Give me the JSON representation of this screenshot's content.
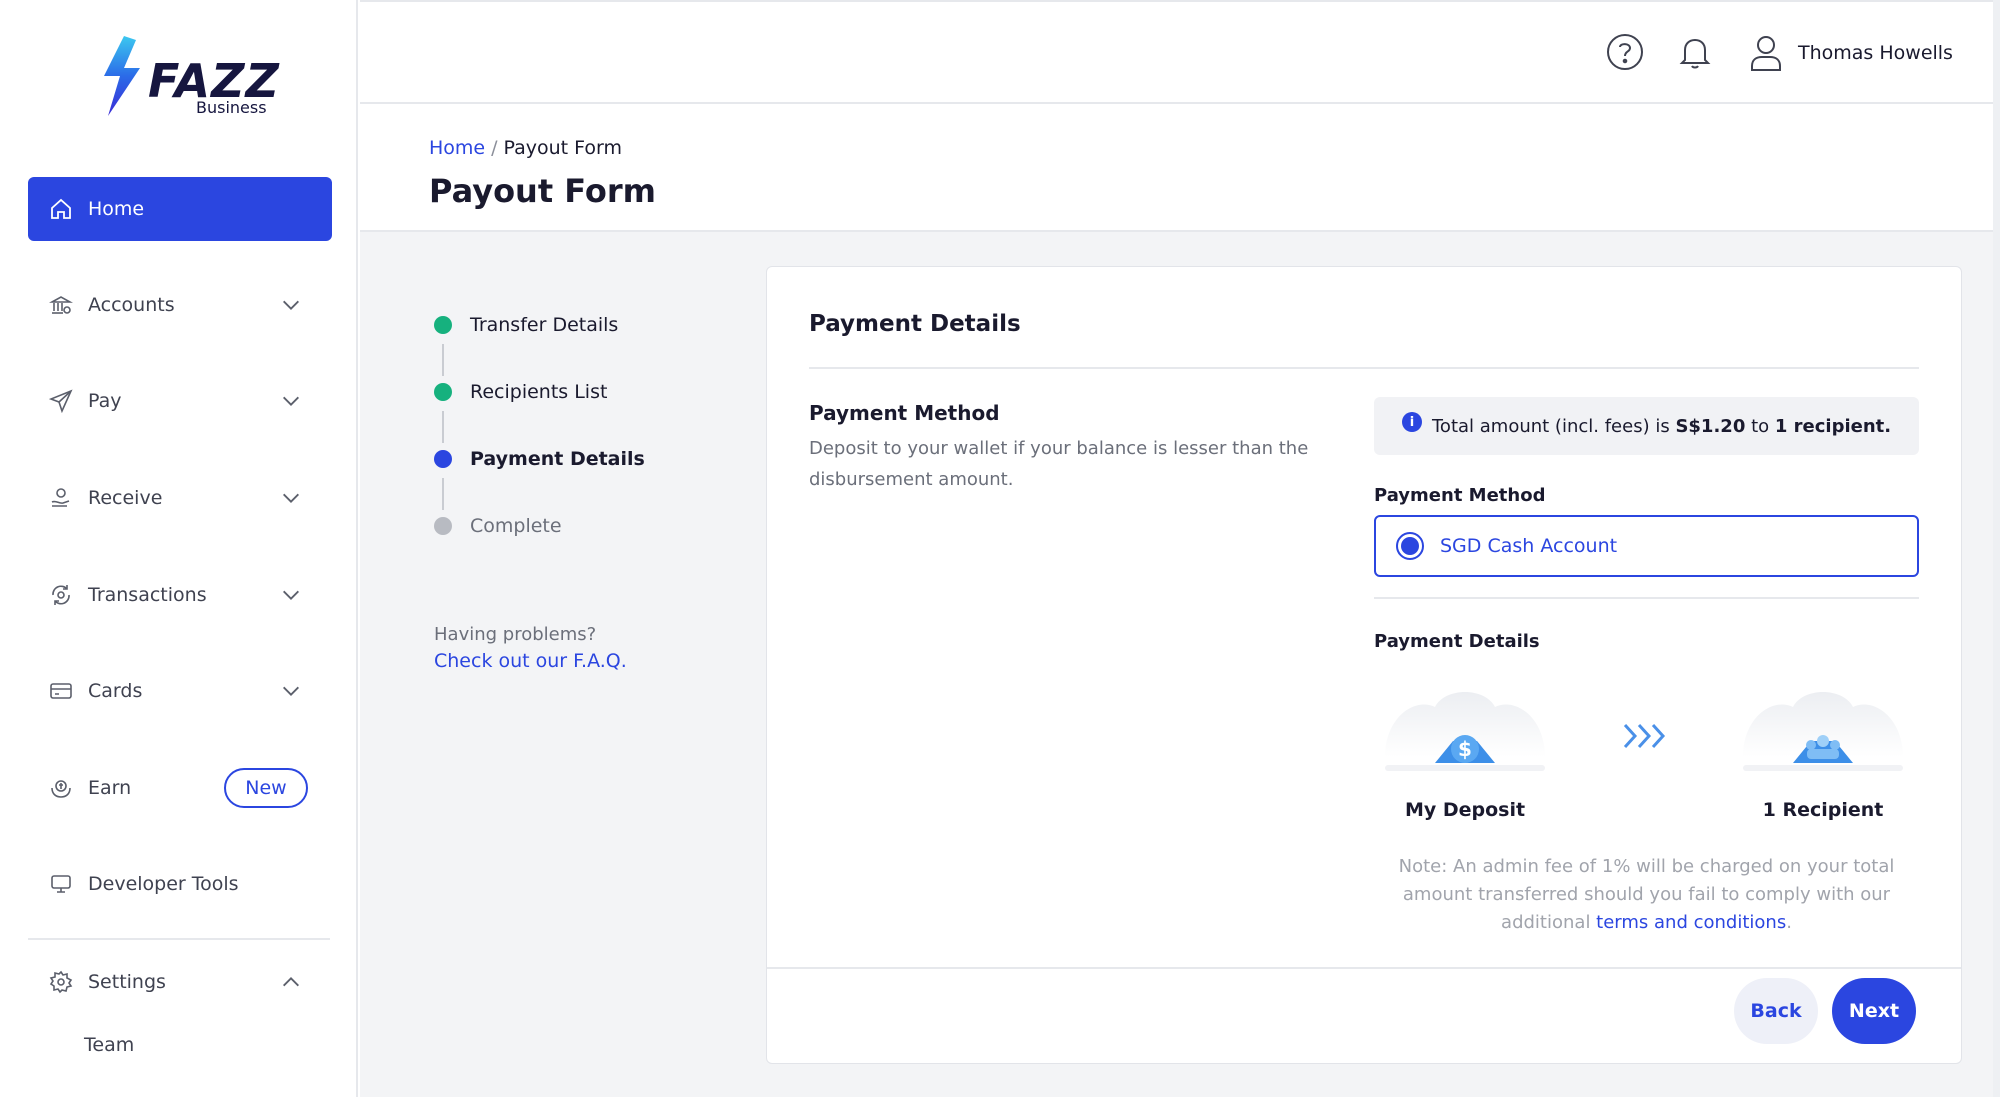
{
  "brand": {
    "name": "FAZZ",
    "subtitle": "Business"
  },
  "sidebar": {
    "items": [
      {
        "label": "Home",
        "icon": "home-icon",
        "active": true
      },
      {
        "label": "Accounts",
        "icon": "bank-icon",
        "expandable": true
      },
      {
        "label": "Pay",
        "icon": "send-icon",
        "expandable": true
      },
      {
        "label": "Receive",
        "icon": "receive-icon",
        "expandable": true
      },
      {
        "label": "Transactions",
        "icon": "transactions-icon",
        "expandable": true
      },
      {
        "label": "Cards",
        "icon": "card-icon",
        "expandable": true
      },
      {
        "label": "Earn",
        "icon": "earn-icon",
        "badge": "New"
      },
      {
        "label": "Developer Tools",
        "icon": "monitor-icon"
      },
      {
        "label": "Settings",
        "icon": "gear-icon",
        "expanded": true
      }
    ],
    "settings_sub": {
      "team": "Team"
    }
  },
  "topbar": {
    "help_icon": "help-icon",
    "bell_icon": "bell-icon",
    "user_icon": "user-icon",
    "user_name": "Thomas Howells"
  },
  "header": {
    "breadcrumb": {
      "home": "Home",
      "separator": "/",
      "current": "Payout Form"
    },
    "title": "Payout Form"
  },
  "stepper": {
    "steps": [
      {
        "label": "Transfer Details",
        "state": "done"
      },
      {
        "label": "Recipients List",
        "state": "done"
      },
      {
        "label": "Payment Details",
        "state": "current"
      },
      {
        "label": "Complete",
        "state": "pending"
      }
    ],
    "help_text": "Having problems?",
    "help_link": "Check out our F.A.Q."
  },
  "card": {
    "title": "Payment Details",
    "section_title": "Payment Method",
    "section_desc": "Deposit to your wallet if your balance is lesser than the disbursement amount.",
    "info": {
      "prefix": "Total amount (incl. fees) is ",
      "amount": "S$1.20",
      "middle": " to ",
      "recipients": "1 recipient."
    },
    "payment_method_label": "Payment Method",
    "payment_method_option": "SGD Cash Account",
    "payment_details_label": "Payment Details",
    "deposit_caption": "My Deposit",
    "recipient_caption": "1 Recipient",
    "note_prefix": "Note: An admin fee of 1% will be charged on your total amount transferred should you fail to comply with our additional ",
    "note_link": "terms and conditions",
    "note_suffix": ".",
    "back_label": "Back",
    "next_label": "Next"
  },
  "colors": {
    "primary": "#2b46e0",
    "success": "#16b17e",
    "pending": "#b8bbc2",
    "text": "#1a1a2e",
    "muted": "#6b6f7a",
    "background": "#f3f4f6"
  }
}
